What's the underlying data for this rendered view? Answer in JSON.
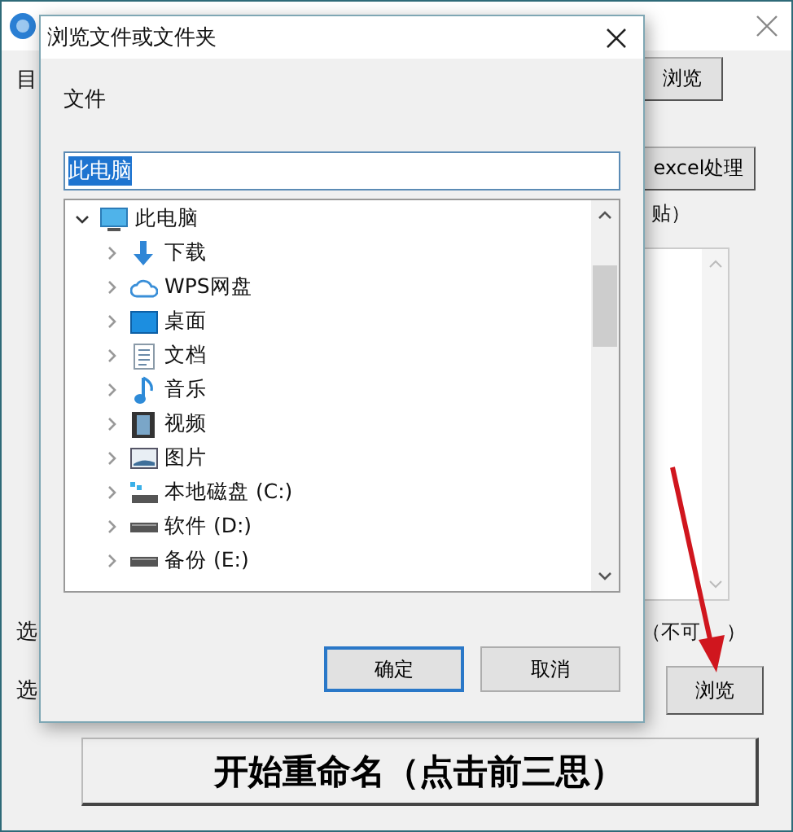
{
  "app": {
    "label_1": "目",
    "browse_button_1": "浏览",
    "excel_button": "excel处理",
    "paste_note": "贴）",
    "label_2": "选",
    "not_selectable_note": "（不可",
    "not_selectable_note_end": "）",
    "label_3": "选",
    "browse_button_2": "浏览",
    "rename_button": "开始重命名（点击前三思）"
  },
  "dialog": {
    "title": "浏览文件或文件夹",
    "label": "文件",
    "path_field": {
      "value": "此电脑"
    },
    "tree": [
      {
        "label": "此电脑",
        "kind": "computer",
        "expanded": true,
        "children": [
          {
            "label": "下载",
            "kind": "download",
            "expanded": false
          },
          {
            "label": "WPS网盘",
            "kind": "cloud",
            "expanded": false
          },
          {
            "label": "桌面",
            "kind": "desktop",
            "expanded": false
          },
          {
            "label": "文档",
            "kind": "document",
            "expanded": false
          },
          {
            "label": "音乐",
            "kind": "music",
            "expanded": false
          },
          {
            "label": "视频",
            "kind": "video",
            "expanded": false
          },
          {
            "label": "图片",
            "kind": "picture",
            "expanded": false
          },
          {
            "label": "本地磁盘 (C:)",
            "kind": "system-drive",
            "expanded": false
          },
          {
            "label": "软件 (D:)",
            "kind": "drive",
            "expanded": false
          },
          {
            "label": "备份 (E:)",
            "kind": "drive",
            "expanded": false
          }
        ]
      }
    ],
    "buttons": [
      {
        "label": "确定",
        "focused": true
      },
      {
        "label": "取消",
        "focused": false
      }
    ]
  }
}
